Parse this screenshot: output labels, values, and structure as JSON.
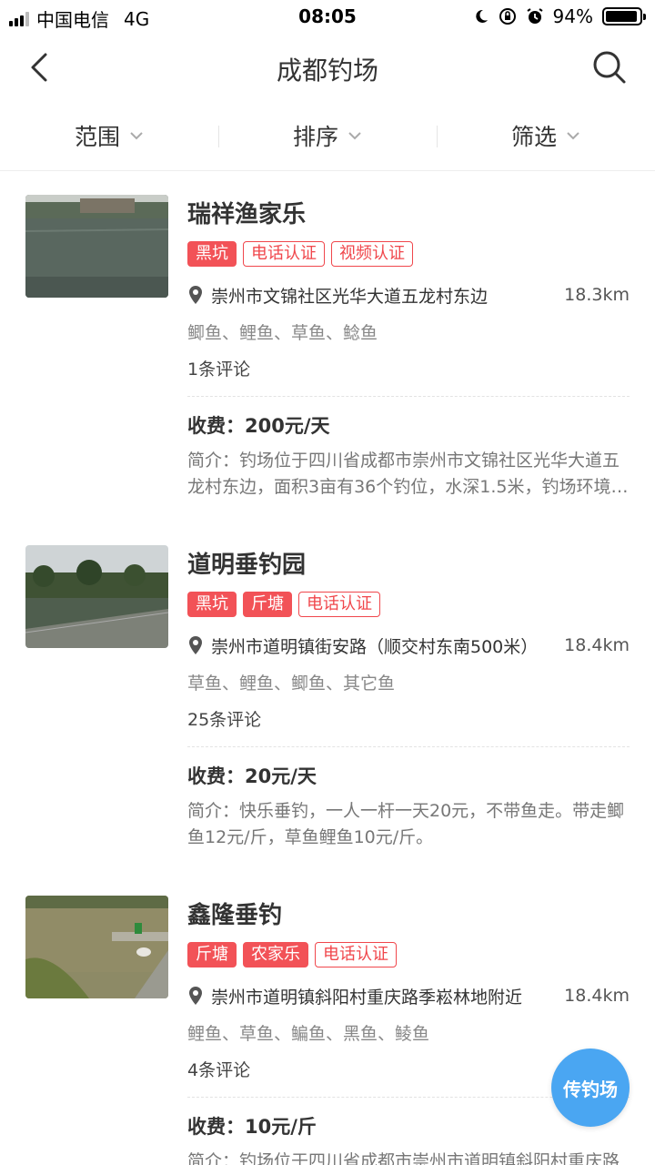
{
  "status_bar": {
    "carrier": "中国电信",
    "network": "4G",
    "time": "08:05",
    "battery": "94%",
    "battery_level": 0.94
  },
  "nav": {
    "title": "成都钓场",
    "back_icon": "chevron-left-icon",
    "search_icon": "search-icon"
  },
  "filters": [
    {
      "label": "范围"
    },
    {
      "label": "排序"
    },
    {
      "label": "筛选"
    }
  ],
  "spots": [
    {
      "name": "瑞祥渔家乐",
      "tags": [
        {
          "label": "黑坑",
          "style": "filled"
        },
        {
          "label": "电话认证",
          "style": "outline"
        },
        {
          "label": "视频认证",
          "style": "outline"
        }
      ],
      "address": "崇州市文锦社区光华大道五龙村东边",
      "distance": "18.3km",
      "fish": "鲫鱼、鲤鱼、草鱼、鲶鱼",
      "reviews": "1条评论",
      "fee": "收费：200元/天",
      "intro": "简介：钓场位于四川省成都市崇州市文锦社区光华大道五龙村东边，面积3亩有36个钓位，水深1.5米，钓场环境优美适合休闲垂钓"
    },
    {
      "name": "道明垂钓园",
      "tags": [
        {
          "label": "黑坑",
          "style": "filled"
        },
        {
          "label": "斤塘",
          "style": "filled"
        },
        {
          "label": "电话认证",
          "style": "outline"
        }
      ],
      "address": "崇州市道明镇街安路（顺交村东南500米）",
      "distance": "18.4km",
      "fish": "草鱼、鲤鱼、鲫鱼、其它鱼",
      "reviews": "25条评论",
      "fee": "收费：20元/天",
      "intro": "简介：快乐垂钓，一人一杆一天20元，不带鱼走。带走鲫鱼12元/斤，草鱼鲤鱼10元/斤。"
    },
    {
      "name": "鑫隆垂钓",
      "tags": [
        {
          "label": "斤塘",
          "style": "filled"
        },
        {
          "label": "农家乐",
          "style": "filled"
        },
        {
          "label": "电话认证",
          "style": "outline"
        }
      ],
      "address": "崇州市道明镇斜阳村重庆路季崧林地附近",
      "distance": "18.4km",
      "fish": "鲤鱼、草鱼、鳊鱼、黑鱼、鲮鱼",
      "reviews": "4条评论",
      "fee": "收费：10元/斤",
      "intro": "简介：钓场位于四川省成都市崇州市道明镇斜阳村重庆路附近"
    }
  ],
  "fab": {
    "label": "传钓场"
  },
  "colors": {
    "accent": "#f25257",
    "fab": "#4aa6f2"
  }
}
